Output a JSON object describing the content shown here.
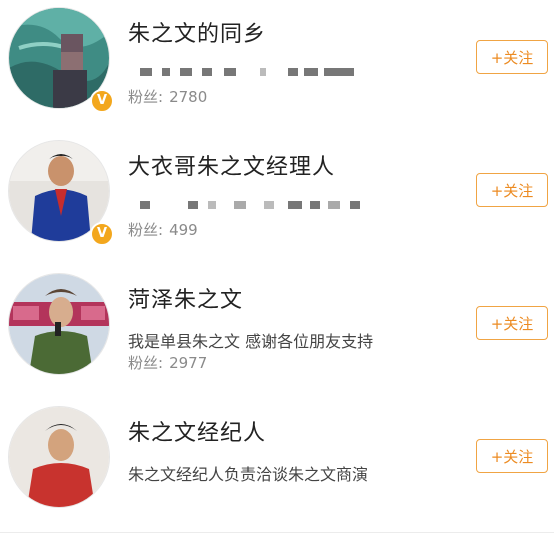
{
  "colors": {
    "accent": "#ec8b22",
    "verified_badge": "#f3a71d"
  },
  "users": [
    {
      "name": "朱之文的同乡",
      "description": "",
      "fans_label": "粉丝:",
      "fans_count": "2780",
      "follow_label": "+关注",
      "verified": true
    },
    {
      "name": "大衣哥朱之文经理人",
      "description": "",
      "fans_label": "粉丝:",
      "fans_count": "499",
      "follow_label": "+关注",
      "verified": true
    },
    {
      "name": "菏泽朱之文",
      "description": "我是单县朱之文 感谢各位朋友支持",
      "fans_label": "粉丝:",
      "fans_count": "2977",
      "follow_label": "+关注",
      "verified": false
    },
    {
      "name": "朱之文经纪人",
      "description": "朱之文经纪人负责洽谈朱之文商演",
      "follow_label": "+关注",
      "verified": false
    }
  ]
}
